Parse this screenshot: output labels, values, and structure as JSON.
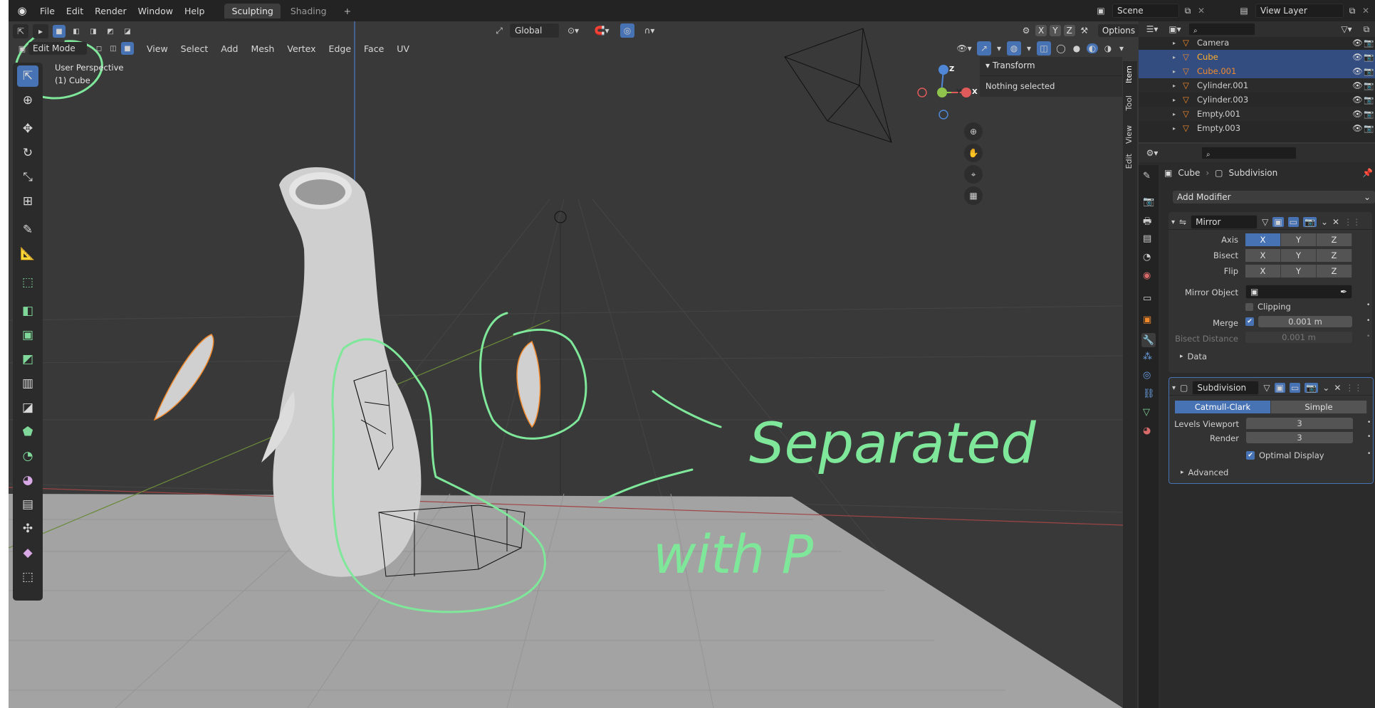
{
  "menu": {
    "file": "File",
    "edit": "Edit",
    "render": "Render",
    "window": "Window",
    "help": "Help"
  },
  "workspaces": {
    "active": "Sculpting",
    "other": "Shading",
    "add": "+"
  },
  "scene": {
    "label": "Scene",
    "view_layer": "View Layer"
  },
  "header": {
    "mode": "Edit Mode",
    "view": "View",
    "select": "Select",
    "add": "Add",
    "mesh": "Mesh",
    "vertex": "Vertex",
    "edge": "Edge",
    "face": "Face",
    "uv": "UV",
    "orientation": "Global",
    "options": "Options",
    "x": "X",
    "y": "Y",
    "z": "Z"
  },
  "viewport": {
    "perspective": "User Perspective",
    "object_label": "(1) Cube",
    "transform_panel_title": "Transform",
    "transform_panel_body": "Nothing selected",
    "gizmo": {
      "x": "X",
      "y": "Y",
      "z": "Z"
    },
    "annotation": {
      "line1": "Separated",
      "line2": "with P"
    }
  },
  "sidebar_tabs": [
    "Item",
    "Tool",
    "View",
    "Edit"
  ],
  "outliner": {
    "items": [
      {
        "name": "Camera",
        "color": "#cfcfcf"
      },
      {
        "name": "Cube",
        "color": "#ffaf29",
        "selected": true
      },
      {
        "name": "Cube.001",
        "color": "#f28a2c",
        "selected": true
      },
      {
        "name": "Cylinder.001",
        "color": "#cfcfcf"
      },
      {
        "name": "Cylinder.003",
        "color": "#cfcfcf"
      },
      {
        "name": "Empty.001",
        "color": "#cfcfcf"
      },
      {
        "name": "Empty.003",
        "color": "#cfcfcf"
      }
    ]
  },
  "properties": {
    "breadcrumb_object": "Cube",
    "breadcrumb_modifier": "Subdivision",
    "add_modifier": "Add Modifier",
    "mirror": {
      "name": "Mirror",
      "axis_label": "Axis",
      "bisect_label": "Bisect",
      "flip_label": "Flip",
      "x": "X",
      "y": "Y",
      "z": "Z",
      "mirror_object_label": "Mirror Object",
      "clipping": "Clipping",
      "merge_label": "Merge",
      "merge_value": "0.001 m",
      "bisect_distance_label": "Bisect Distance",
      "bisect_distance_value": "0.001 m",
      "data_label": "Data"
    },
    "subdivision": {
      "name": "Subdivision",
      "catmull": "Catmull-Clark",
      "simple": "Simple",
      "levels_viewport_label": "Levels Viewport",
      "levels_viewport_value": "3",
      "render_label": "Render",
      "render_value": "3",
      "optimal_display": "Optimal Display",
      "advanced_label": "Advanced"
    }
  },
  "colors": {
    "accent": "#4772b3",
    "annotation": "#7fe79a",
    "selection": "#f28a2c"
  }
}
